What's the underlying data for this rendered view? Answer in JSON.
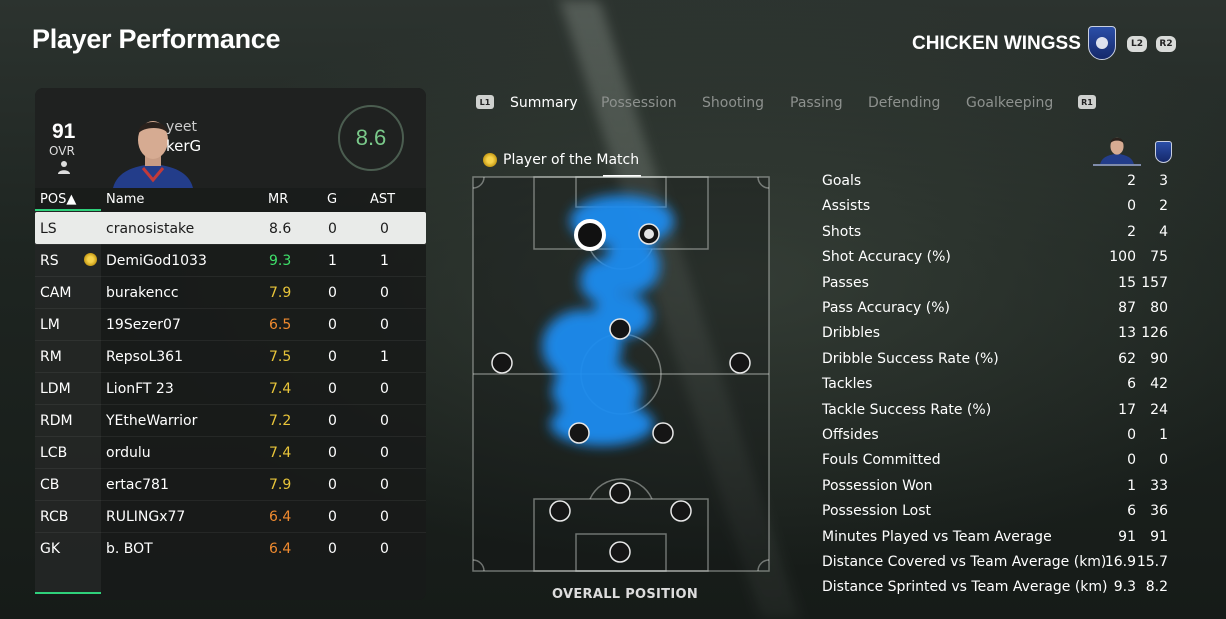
{
  "header": {
    "title": "Player Performance",
    "team_name": "CHICKEN WINGSS",
    "l2": "L2",
    "r2": "R2"
  },
  "player_card": {
    "ovr": "91",
    "ovr_label": "OVR",
    "first_name": "yeet",
    "last_name": "kerG",
    "match_rating": "8.6"
  },
  "table": {
    "headers": {
      "pos": "POS▲",
      "name": "Name",
      "mr": "MR",
      "g": "G",
      "ast": "AST"
    },
    "rows": [
      {
        "pos": "LS",
        "name": "cranosistake",
        "mr": "8.6",
        "g": "0",
        "ast": "0",
        "mr_color": "#1b1b1b",
        "selected": true,
        "potm": false
      },
      {
        "pos": "RS",
        "name": "DemiGod1033",
        "mr": "9.3",
        "g": "1",
        "ast": "1",
        "mr_color": "#3fe06a",
        "selected": false,
        "potm": true
      },
      {
        "pos": "CAM",
        "name": "burakencc",
        "mr": "7.9",
        "g": "0",
        "ast": "0",
        "mr_color": "#e8c53a",
        "selected": false,
        "potm": false
      },
      {
        "pos": "LM",
        "name": "19Sezer07",
        "mr": "6.5",
        "g": "0",
        "ast": "0",
        "mr_color": "#ef8a2f",
        "selected": false,
        "potm": false
      },
      {
        "pos": "RM",
        "name": "RepsoL361",
        "mr": "7.5",
        "g": "0",
        "ast": "1",
        "mr_color": "#e8c53a",
        "selected": false,
        "potm": false
      },
      {
        "pos": "LDM",
        "name": "LionFT 23",
        "mr": "7.4",
        "g": "0",
        "ast": "0",
        "mr_color": "#e8c53a",
        "selected": false,
        "potm": false
      },
      {
        "pos": "RDM",
        "name": "YEtheWarrior",
        "mr": "7.2",
        "g": "0",
        "ast": "0",
        "mr_color": "#e8c53a",
        "selected": false,
        "potm": false
      },
      {
        "pos": "LCB",
        "name": "ordulu",
        "mr": "7.4",
        "g": "0",
        "ast": "0",
        "mr_color": "#e8c53a",
        "selected": false,
        "potm": false
      },
      {
        "pos": "CB",
        "name": "ertac781",
        "mr": "7.9",
        "g": "0",
        "ast": "0",
        "mr_color": "#e8c53a",
        "selected": false,
        "potm": false
      },
      {
        "pos": "RCB",
        "name": "RULINGx77",
        "mr": "6.4",
        "g": "0",
        "ast": "0",
        "mr_color": "#ef8a2f",
        "selected": false,
        "potm": false
      },
      {
        "pos": "GK",
        "name": "b. BOT",
        "mr": "6.4",
        "g": "0",
        "ast": "0",
        "mr_color": "#ef8a2f",
        "selected": false,
        "potm": false
      }
    ]
  },
  "tabs": {
    "l1": "L1",
    "r1": "R1",
    "items": [
      "Summary",
      "Possession",
      "Shooting",
      "Passing",
      "Defending",
      "Goalkeeping"
    ],
    "active": "Summary"
  },
  "pitch": {
    "potm_label": "Player of the Match",
    "caption": "OVERALL POSITION"
  },
  "stats": [
    {
      "label": "Goals",
      "player": "2",
      "team": "3"
    },
    {
      "label": "Assists",
      "player": "0",
      "team": "2"
    },
    {
      "label": "Shots",
      "player": "2",
      "team": "4"
    },
    {
      "label": "Shot Accuracy (%)",
      "player": "100",
      "team": "75"
    },
    {
      "label": "Passes",
      "player": "15",
      "team": "157"
    },
    {
      "label": "Pass Accuracy (%)",
      "player": "87",
      "team": "80"
    },
    {
      "label": "Dribbles",
      "player": "13",
      "team": "126"
    },
    {
      "label": "Dribble Success Rate (%)",
      "player": "62",
      "team": "90"
    },
    {
      "label": "Tackles",
      "player": "6",
      "team": "42"
    },
    {
      "label": "Tackle Success Rate (%)",
      "player": "17",
      "team": "24"
    },
    {
      "label": "Offsides",
      "player": "0",
      "team": "1"
    },
    {
      "label": "Fouls Committed",
      "player": "0",
      "team": "0"
    },
    {
      "label": "Possession Won",
      "player": "1",
      "team": "33"
    },
    {
      "label": "Possession Lost",
      "player": "6",
      "team": "36"
    },
    {
      "label": "Minutes Played vs Team Average",
      "player": "91",
      "team": "91"
    },
    {
      "label": "Distance Covered vs Team Average (km)",
      "player": "16.9",
      "team": "15.7"
    },
    {
      "label": "Distance Sprinted vs Team Average (km)",
      "player": "9.3",
      "team": "8.2"
    }
  ]
}
